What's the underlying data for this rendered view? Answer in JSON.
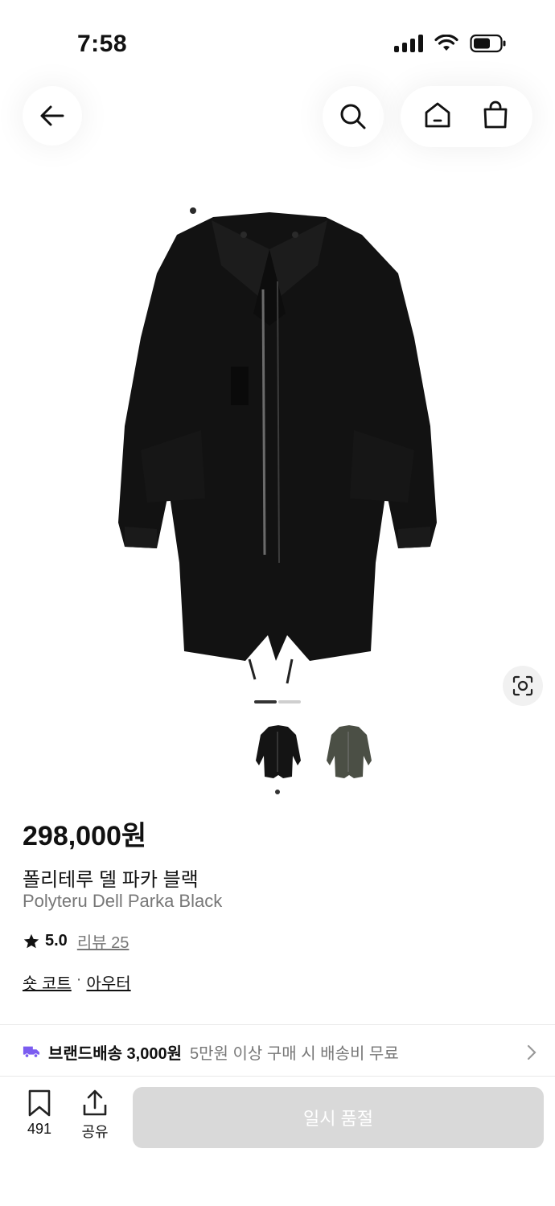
{
  "status": {
    "time": "7:58"
  },
  "product": {
    "price": "298,000원",
    "name_ko": "폴리테루 델 파카 블랙",
    "name_en": "Polyteru Dell Parka Black",
    "rating": "5.0",
    "review_label": "리뷰 25",
    "category_main": "숏 코트",
    "category_sep": "·",
    "category_sub": "아우터",
    "image_count": 2,
    "active_image": 1
  },
  "shipping": {
    "title": "브랜드배송 3,000원",
    "note": "5만원 이상 구매 시 배송비 무료",
    "icon": "truck-icon",
    "icon_color": "#7b5cf0"
  },
  "bottom_bar": {
    "bookmark_count": "491",
    "share_label": "공유",
    "buy_button_label": "일시 품절",
    "buy_button_color": "#d9d9d9"
  }
}
